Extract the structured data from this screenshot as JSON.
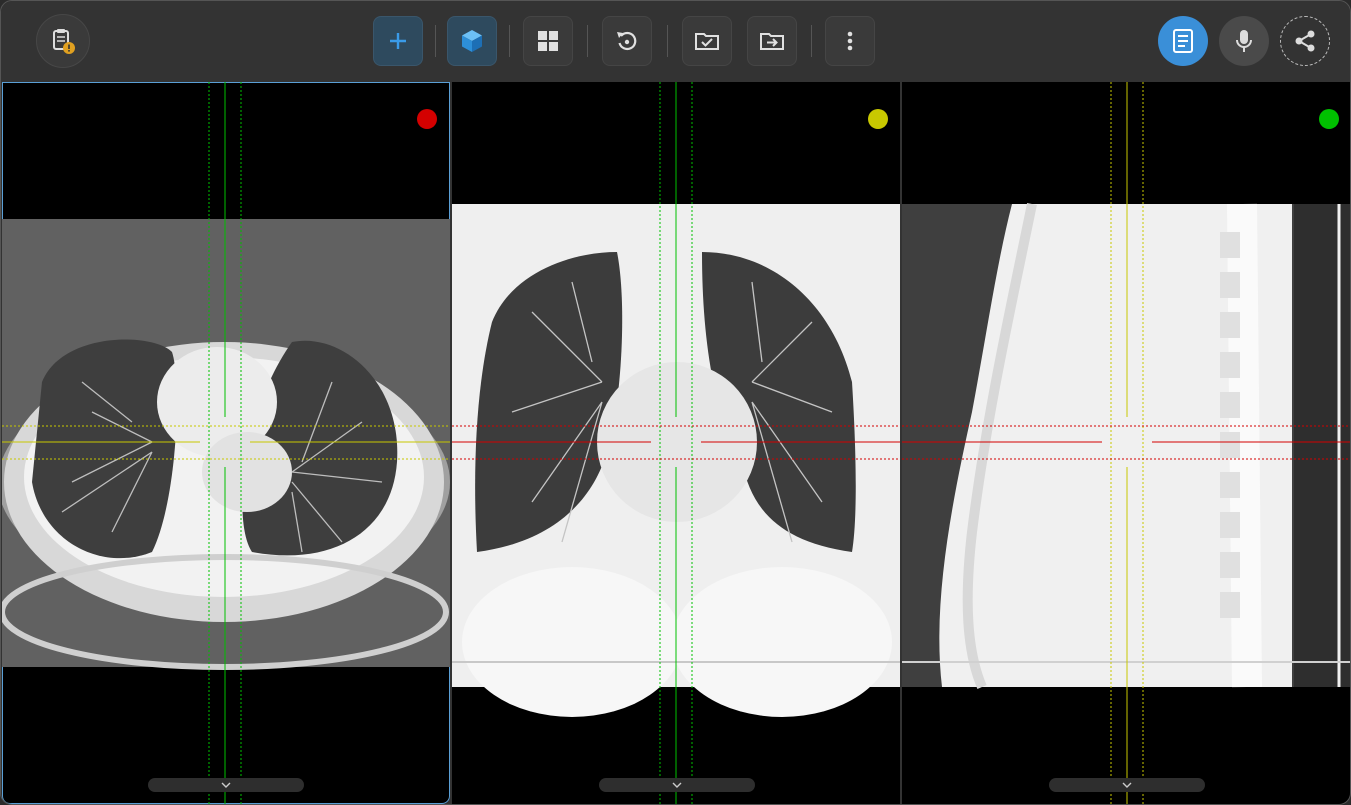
{
  "toolbar": {
    "left": [
      {
        "name": "report-clipboard-icon",
        "label": "report"
      }
    ],
    "center": [
      {
        "name": "add-icon"
      },
      {
        "name": "cube-3d-icon"
      },
      {
        "name": "grid-layout-icon"
      },
      {
        "name": "reset-rotate-icon"
      },
      {
        "name": "folder-check-icon"
      },
      {
        "name": "folder-export-icon"
      },
      {
        "name": "more-vertical-icon"
      }
    ],
    "right": [
      {
        "name": "report-document-icon"
      },
      {
        "name": "microphone-icon"
      },
      {
        "name": "share-icon"
      }
    ]
  },
  "colors": {
    "accent": "#3a8fd8",
    "axial": "#d40000",
    "coronal": "#c8c800",
    "sagittal": "#00c000",
    "toolbar_bg": "#333333"
  },
  "viewports": [
    {
      "name": "axial",
      "indicator_color": "#d40000"
    },
    {
      "name": "coronal",
      "indicator_color": "#c8c800"
    },
    {
      "name": "sagittal",
      "indicator_color": "#00c000"
    }
  ]
}
